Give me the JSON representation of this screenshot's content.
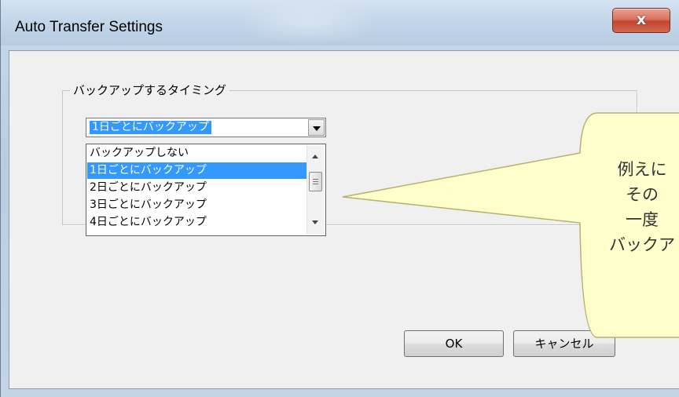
{
  "window": {
    "title": "Auto Transfer Settings",
    "close_glyph": "x"
  },
  "group": {
    "label": "バックアップするタイミング"
  },
  "combo": {
    "selected_value": "1日ごとにバックアップ"
  },
  "dropdown": {
    "items": [
      "バックアップしない",
      "1日ごとにバックアップ",
      "2日ごとにバックアップ",
      "3日ごとにバックアップ",
      "4日ごとにバックアップ"
    ],
    "selected_index": 1
  },
  "buttons": {
    "ok_label": "OK",
    "cancel_label": "キャンセル"
  },
  "callout": {
    "lines": [
      "例えに",
      "その",
      "一度",
      "バックア"
    ]
  },
  "colors": {
    "selection": "#3399ff",
    "callout_fill": "#ffffcc",
    "callout_stroke": "#b8b070",
    "close_button": "#c2462f"
  }
}
